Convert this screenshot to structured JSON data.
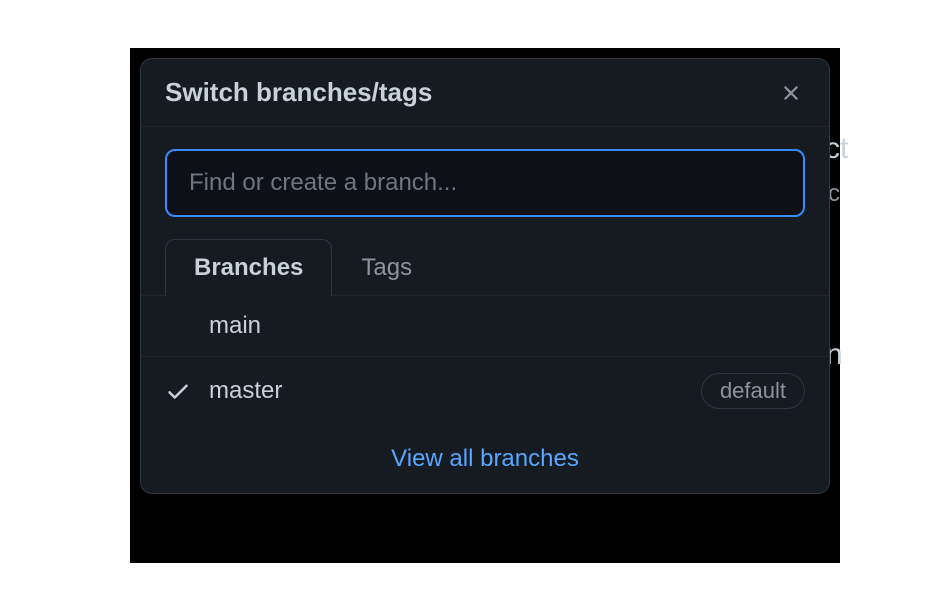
{
  "header": {
    "title": "Switch branches/tags"
  },
  "search": {
    "placeholder": "Find or create a branch...",
    "value": ""
  },
  "tabs": {
    "branches": "Branches",
    "tags": "Tags",
    "active": "branches"
  },
  "branches": [
    {
      "name": "main",
      "selected": false,
      "default": false
    },
    {
      "name": "master",
      "selected": true,
      "default": true
    }
  ],
  "default_badge": "default",
  "footer": {
    "view_all": "View all branches"
  },
  "bg_fragments": {
    "a": "ct",
    "b": "c",
    "c": "n"
  }
}
